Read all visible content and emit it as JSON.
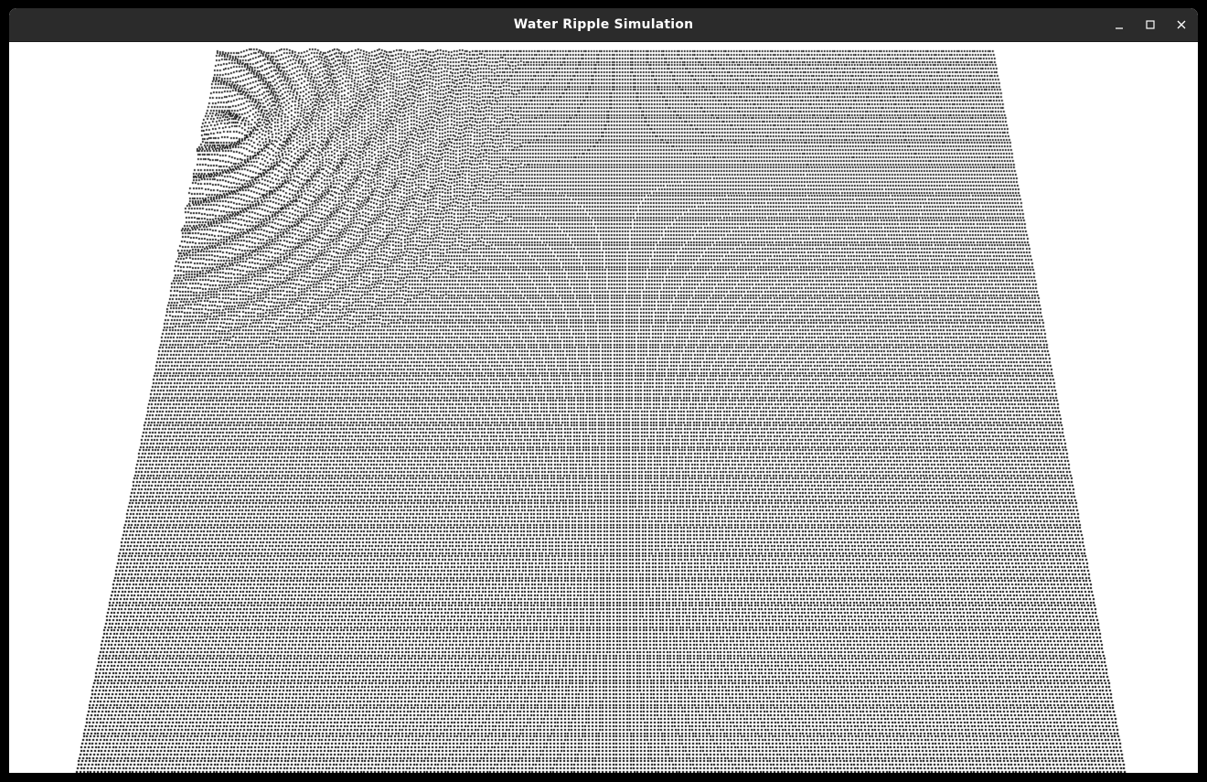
{
  "window": {
    "title": "Water Ripple Simulation",
    "controls": {
      "minimize_icon": "minimize-icon",
      "maximize_icon": "maximize-icon",
      "close_icon": "close-icon"
    }
  },
  "theme": {
    "titlebar_color": "#2b2b2b",
    "title_text_color": "#ffffff",
    "canvas_background": "#ffffff",
    "mesh_point_color": "#000000"
  }
}
